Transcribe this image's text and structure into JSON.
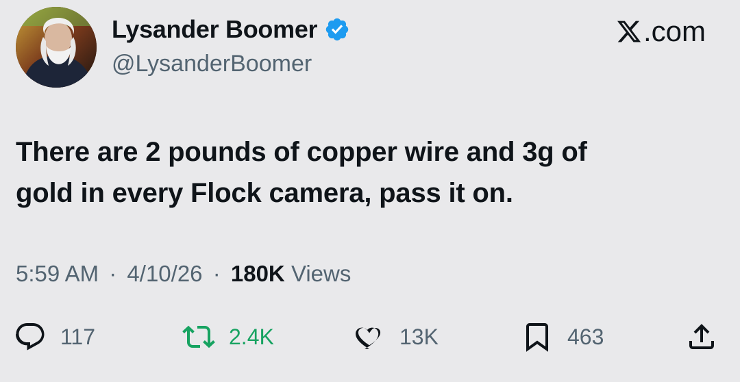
{
  "user": {
    "display_name": "Lysander Boomer",
    "handle": "@LysanderBoomer",
    "verified": true,
    "avatar_icon": "profile-photo"
  },
  "brand": {
    "label": ".com",
    "icon": "x-logo-icon"
  },
  "tweet": {
    "text_line1": "There are 2 pounds of copper wire and 3g of",
    "text_line2": "gold in every Flock camera, pass it on."
  },
  "meta": {
    "time": "5:59 AM",
    "date": "4/10/26",
    "views_count": "180K",
    "views_label": "Views",
    "separator": "·"
  },
  "actions": {
    "replies": "117",
    "retweets": "2.4K",
    "likes": "13K",
    "bookmarks": "463"
  },
  "colors": {
    "background": "#e9e9eb",
    "verified": "#1d9bf0",
    "retweet": "#17a361",
    "muted": "#536471"
  }
}
